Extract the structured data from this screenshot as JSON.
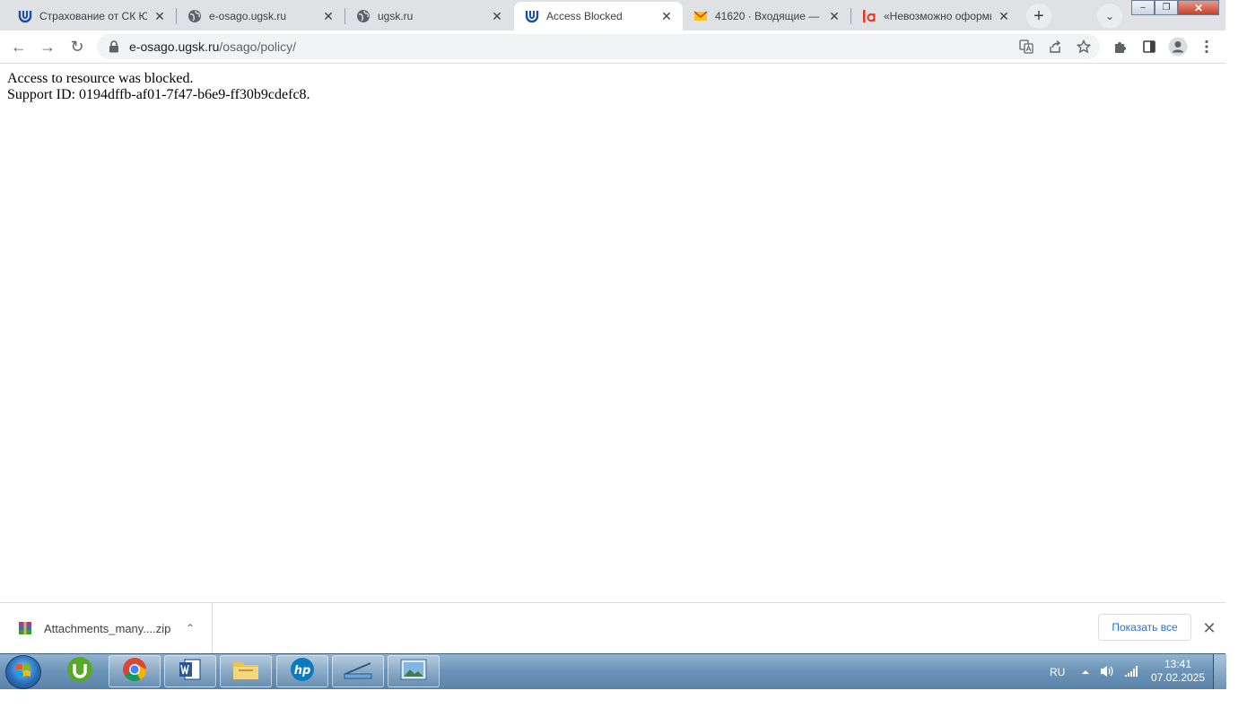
{
  "tabs": [
    {
      "title": "Страхование от СК Юг",
      "icon": "ugsk-logo-icon",
      "active": false
    },
    {
      "title": "e-osago.ugsk.ru",
      "icon": "globe-icon",
      "active": false
    },
    {
      "title": "ugsk.ru",
      "icon": "globe-icon",
      "active": false
    },
    {
      "title": "Access Blocked",
      "icon": "ugsk-logo-icon",
      "active": true
    },
    {
      "title": "41620 · Входящие — Я",
      "icon": "mail-icon",
      "active": false
    },
    {
      "title": "«Невозможно оформи",
      "icon": "a-logo-icon",
      "active": false
    }
  ],
  "tab_close_glyph": "✕",
  "new_tab_glyph": "+",
  "tab_search_glyph": "⌄",
  "window_controls": {
    "minimize": "–",
    "restore": "❐",
    "close": "✕"
  },
  "toolbar": {
    "back_glyph": "←",
    "forward_glyph": "→",
    "reload_glyph": "↻"
  },
  "address": {
    "host": "e-osago.ugsk.ru",
    "path": "/osago/policy/"
  },
  "page": {
    "line1": "Access to resource was blocked.",
    "line2": "Support ID: 0194dffb-af01-7f47-b6e9-ff30b9cdefc8."
  },
  "downloads": {
    "file_name": "Attachments_many....zip",
    "chevron_glyph": "⌃",
    "show_all_label": "Показать все",
    "close_glyph": "✕"
  },
  "taskbar": {
    "language": "RU",
    "time": "13:41",
    "date": "07.02.2025"
  },
  "colors": {
    "tab_strip": "#dfe1e5",
    "link_blue": "#1a73e8",
    "ugsk_blue": "#1b4fa0",
    "mail_yellow": "#f5c518",
    "a_logo_red": "#e53917"
  }
}
